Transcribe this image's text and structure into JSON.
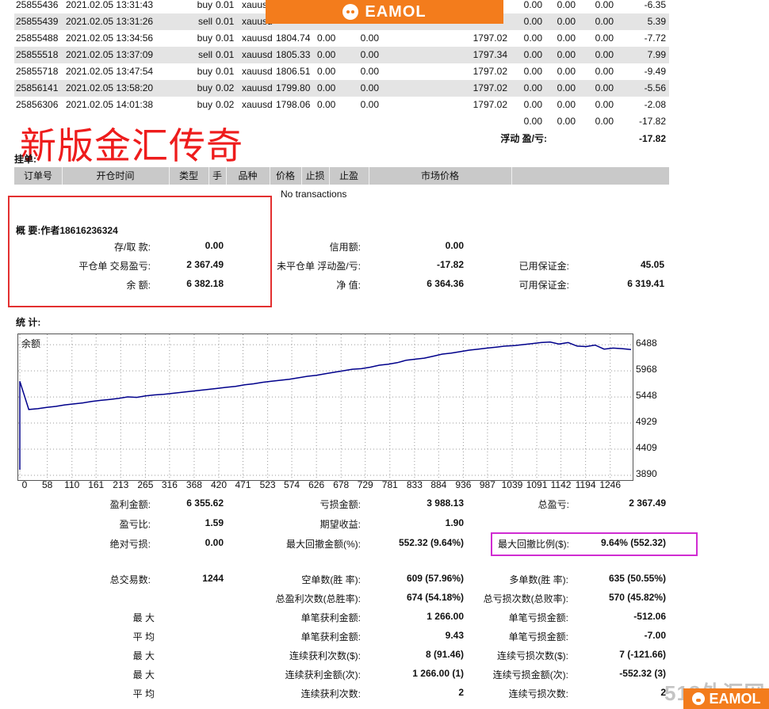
{
  "trades": [
    {
      "ticket": "25855436",
      "time": "2021.02.05 13:31:43",
      "type": "buy",
      "size": "0.01",
      "item": "xauusd",
      "price": "",
      "sl": "",
      "tp": "",
      "cur": "",
      "comm": "0.00",
      "tax": "0.00",
      "swap": "0.00",
      "profit": "-6.35"
    },
    {
      "ticket": "25855439",
      "time": "2021.02.05 13:31:26",
      "type": "sell",
      "size": "0.01",
      "item": "xauusd",
      "price": "",
      "sl": "",
      "tp": "",
      "cur": "",
      "comm": "0.00",
      "tax": "0.00",
      "swap": "0.00",
      "profit": "5.39"
    },
    {
      "ticket": "25855488",
      "time": "2021.02.05 13:34:56",
      "type": "buy",
      "size": "0.01",
      "item": "xauusd",
      "price": "1804.74",
      "sl": "0.00",
      "tp": "0.00",
      "cur": "1797.02",
      "comm": "0.00",
      "tax": "0.00",
      "swap": "0.00",
      "profit": "-7.72"
    },
    {
      "ticket": "25855518",
      "time": "2021.02.05 13:37:09",
      "type": "sell",
      "size": "0.01",
      "item": "xauusd",
      "price": "1805.33",
      "sl": "0.00",
      "tp": "0.00",
      "cur": "1797.34",
      "comm": "0.00",
      "tax": "0.00",
      "swap": "0.00",
      "profit": "7.99"
    },
    {
      "ticket": "25855718",
      "time": "2021.02.05 13:47:54",
      "type": "buy",
      "size": "0.01",
      "item": "xauusd",
      "price": "1806.51",
      "sl": "0.00",
      "tp": "0.00",
      "cur": "1797.02",
      "comm": "0.00",
      "tax": "0.00",
      "swap": "0.00",
      "profit": "-9.49"
    },
    {
      "ticket": "25856141",
      "time": "2021.02.05 13:58:20",
      "type": "buy",
      "size": "0.02",
      "item": "xauusd",
      "price": "1799.80",
      "sl": "0.00",
      "tp": "0.00",
      "cur": "1797.02",
      "comm": "0.00",
      "tax": "0.00",
      "swap": "0.00",
      "profit": "-5.56"
    },
    {
      "ticket": "25856306",
      "time": "2021.02.05 14:01:38",
      "type": "buy",
      "size": "0.02",
      "item": "xauusd",
      "price": "1798.06",
      "sl": "0.00",
      "tp": "0.00",
      "cur": "1797.02",
      "comm": "0.00",
      "tax": "0.00",
      "swap": "0.00",
      "profit": "-2.08"
    }
  ],
  "totals": {
    "comm": "0.00",
    "tax": "0.00",
    "swap": "0.00",
    "profit": "-17.82"
  },
  "floating": {
    "label": "浮动 盈/亏:",
    "value": "-17.82"
  },
  "banner": {
    "brand": "EAMOL",
    "brand_color": "#f37c1c"
  },
  "headline": "新版金汇传奇",
  "pending": {
    "title": "挂单:",
    "columns": [
      "订单号",
      "开仓时间",
      "类型",
      "手",
      "品种",
      "价格",
      "止损",
      "止盈",
      "市场价格"
    ],
    "empty": "No transactions"
  },
  "summary": {
    "title": "概 要:作者18616236324",
    "rows": [
      [
        {
          "label": "存/取 款:",
          "value": "0.00"
        },
        {
          "label": "信用额:",
          "value": "0.00"
        },
        {
          "label": "",
          "value": ""
        }
      ],
      [
        {
          "label": "平仓单 交易盈亏:",
          "value": "2 367.49"
        },
        {
          "label": "未平仓单 浮动盈/亏:",
          "value": "-17.82"
        },
        {
          "label": "已用保证金:",
          "value": "45.05"
        }
      ],
      [
        {
          "label": "余 额:",
          "value": "6 382.18"
        },
        {
          "label": "净 值:",
          "value": "6 364.36"
        },
        {
          "label": "可用保证金:",
          "value": "6 319.41"
        }
      ]
    ]
  },
  "stats_title": "统 计:",
  "chart_data": {
    "type": "line",
    "title": "余额",
    "series": [
      {
        "values": [
          4000,
          5760,
          5200,
          5215,
          5240,
          5260,
          5290,
          5310,
          5330,
          5360,
          5380,
          5400,
          5420,
          5450,
          5440,
          5470,
          5490,
          5500,
          5520,
          5540,
          5560,
          5580,
          5600,
          5620,
          5640,
          5660,
          5690,
          5710,
          5740,
          5760,
          5780,
          5800,
          5830,
          5860,
          5880,
          5910,
          5940,
          5970,
          6000,
          6010,
          6040,
          6080,
          6100,
          6130,
          6180,
          6200,
          6220,
          6260,
          6300,
          6320,
          6350,
          6380,
          6400,
          6420,
          6440,
          6460,
          6470,
          6490,
          6510,
          6530,
          6540,
          6500,
          6530,
          6460,
          6450,
          6480,
          6400,
          6420,
          6410,
          6390
        ]
      }
    ],
    "x": [
      0,
      58,
      110,
      161,
      213,
      265,
      316,
      368,
      420,
      471,
      523,
      574,
      626,
      678,
      729,
      781,
      833,
      884,
      936,
      987,
      1039,
      1091,
      1142,
      1194,
      1246
    ],
    "y_ticks": [
      6488,
      5968,
      5448,
      4929,
      4409,
      3890
    ],
    "ylim": [
      3890,
      6600
    ],
    "xlim": [
      0,
      1290
    ],
    "line_color": "#00008b"
  },
  "results": {
    "row1": [
      {
        "label": "盈利金额:",
        "value": "6 355.62"
      },
      {
        "label": "亏损金额:",
        "value": "3 988.13"
      },
      {
        "label": "总盈亏:",
        "value": "2 367.49"
      }
    ],
    "row2": [
      {
        "label": "盈亏比:",
        "value": "1.59"
      },
      {
        "label": "期望收益:",
        "value": "1.90"
      },
      {
        "label": "",
        "value": ""
      }
    ],
    "row3": [
      {
        "label": "绝对亏损:",
        "value": "0.00"
      },
      {
        "label": "最大回撤金额(%):",
        "value": "552.32 (9.64%)"
      },
      {
        "label": "最大回撤比例($):",
        "value": "9.64% (552.32)"
      }
    ]
  },
  "totals_stats": {
    "trades": {
      "label": "总交易数:",
      "value": "1244"
    },
    "rows": [
      [
        {
          "label": "空单数(胜 率):",
          "value": "609 (57.96%)"
        },
        {
          "label": "多单数(胜 率):",
          "value": "635 (50.55%)"
        }
      ],
      [
        {
          "label": "总盈利次数(总胜率):",
          "value": "674 (54.18%)"
        },
        {
          "label": "总亏损次数(总败率):",
          "value": "570 (45.82%)"
        }
      ],
      [
        {
          "side": "最 大",
          "label": "单笔获利金额:",
          "value": "1 266.00"
        },
        {
          "label": "单笔亏损金额:",
          "value": "-512.06"
        }
      ],
      [
        {
          "side": "平 均",
          "label": "单笔获利金额:",
          "value": "9.43"
        },
        {
          "label": "单笔亏损金额:",
          "value": "-7.00"
        }
      ],
      [
        {
          "side": "最 大",
          "label": "连续获利次数($):",
          "value": "8 (91.46)"
        },
        {
          "label": "连续亏损次数($):",
          "value": "7 (-121.66)"
        }
      ],
      [
        {
          "side": "最 大",
          "label": "连续获利金额(次):",
          "value": "1 266.00 (1)"
        },
        {
          "label": "连续亏损金额(次):",
          "value": "-552.32 (3)"
        }
      ],
      [
        {
          "side": "平 均",
          "label": "连续获利次数:",
          "value": "2"
        },
        {
          "label": "连续亏损次数:",
          "value": "2"
        }
      ]
    ]
  },
  "watermark": "518外汇网",
  "corner_brand": "EAMOL"
}
